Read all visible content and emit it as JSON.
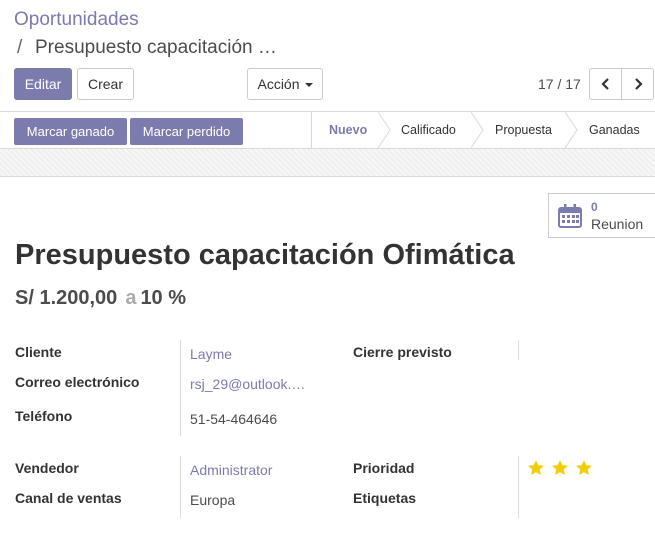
{
  "breadcrumb": {
    "root": "Oportunidades",
    "separator": "/",
    "current": "Presupuesto capacitación …"
  },
  "toolbar": {
    "edit_label": "Editar",
    "create_label": "Crear",
    "action_label": "Acción"
  },
  "pager": {
    "value": "17 / 17"
  },
  "statusbar": {
    "won_label": "Marcar ganado",
    "lost_label": "Marcar perdido",
    "stages": [
      "Nuevo",
      "Calificado",
      "Propuesta",
      "Ganadas"
    ],
    "active_stage": "Nuevo"
  },
  "smart_button": {
    "count": "0",
    "label": "Reunion",
    "icon": "calendar-icon"
  },
  "record": {
    "title": "Presupuesto capacitación Ofimática",
    "revenue": "S/ 1.200,00",
    "at": "a",
    "probability": "10 %"
  },
  "fields": {
    "cliente_label": "Cliente",
    "cliente_value": "Layme",
    "correo_label": "Correo electrónico",
    "correo_value": "rsj_29@outlook.…",
    "telefono_label": "Teléfono",
    "telefono_value": "51-54-464646",
    "cierre_label": "Cierre previsto",
    "vendedor_label": "Vendedor",
    "vendedor_value": "Administrator",
    "canal_label": "Canal de ventas",
    "canal_value": "Europa",
    "prioridad_label": "Prioridad",
    "prioridad_stars": 3,
    "etiquetas_label": "Etiquetas"
  },
  "colors": {
    "primary": "#7c7bad",
    "star": "#f3cc00"
  }
}
